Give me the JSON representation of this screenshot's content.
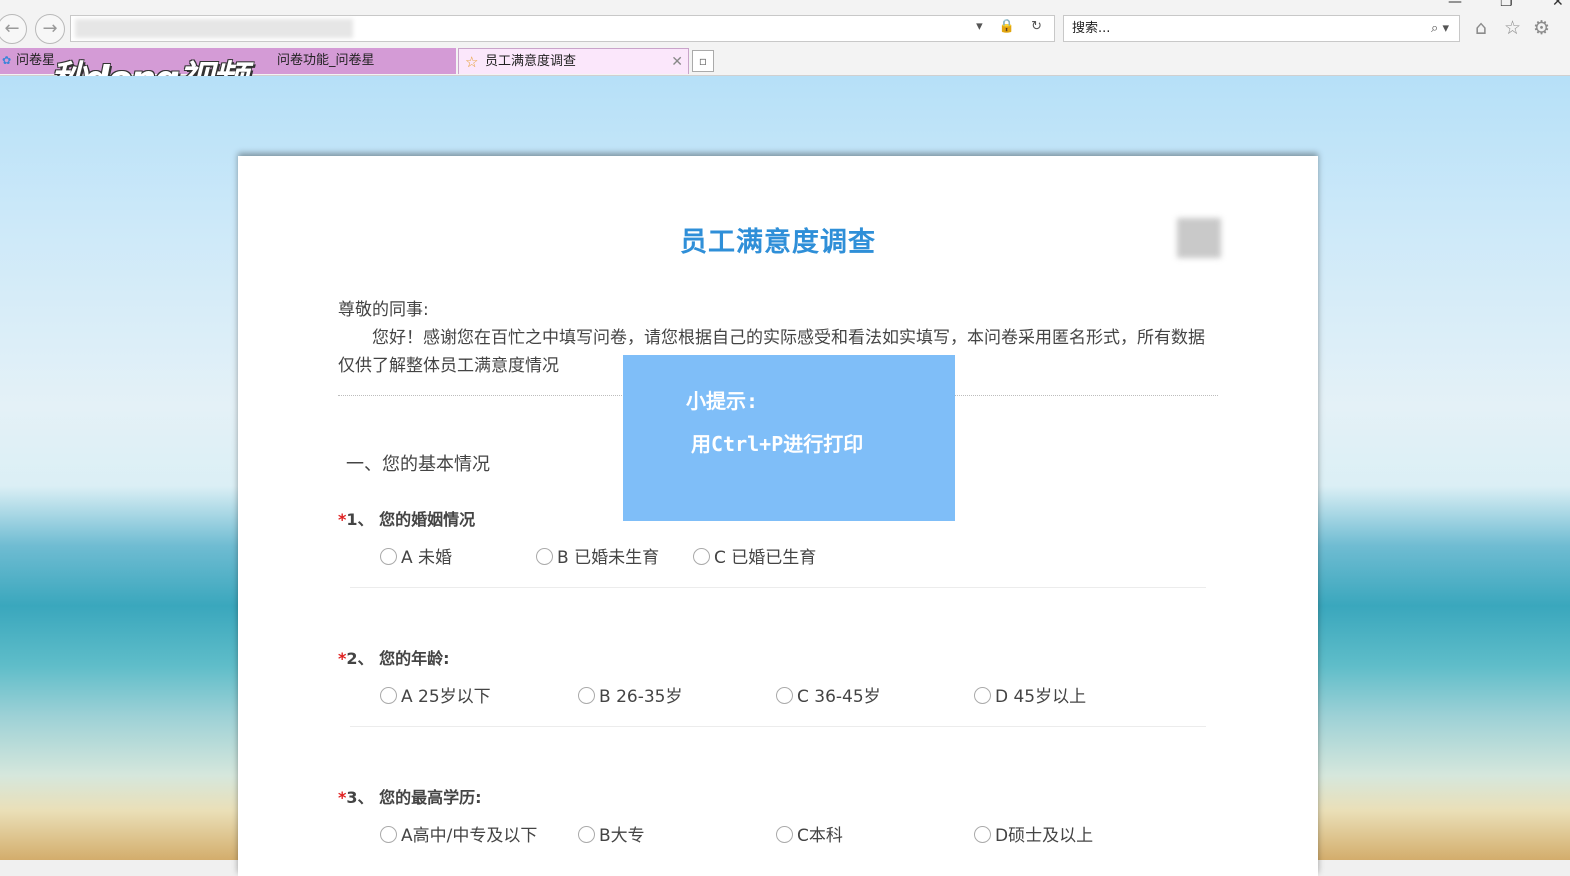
{
  "browser": {
    "search_placeholder": "搜索...",
    "addr_icons": "▾ 🔒 ↻",
    "search_icon": "⌕ ▾",
    "tabs": [
      {
        "label": "问卷星"
      },
      {
        "label": "问卷功能_问卷星"
      },
      {
        "label": "员工满意度调查"
      }
    ]
  },
  "watermark": {
    "logo": "秒dong视频"
  },
  "survey": {
    "title": "员工满意度调查",
    "greeting": "尊敬的同事:",
    "intro": "您好！感谢您在百忙之中填写问卷，请您根据自己的实际感受和看法如实填写，本问卷采用匿名形式，所有数据仅供了解整体员工满意度情况",
    "section": "一、您的基本情况",
    "questions": [
      {
        "required": "*",
        "title": "1、 您的婚姻情况",
        "options": [
          "A 未婚",
          "B 已婚未生育",
          "C 已婚已生育"
        ]
      },
      {
        "required": "*",
        "title": "2、 您的年龄:",
        "options": [
          "A 25岁以下",
          "B 26-35岁",
          "C 36-45岁",
          "D 45岁以上"
        ]
      },
      {
        "required": "*",
        "title": "3、 您的最高学历:",
        "options": [
          "A高中/中专及以下",
          "B大专",
          "C本科",
          "D硕士及以上"
        ]
      }
    ]
  },
  "tip": {
    "title": "小提示:",
    "body": "用Ctrl+P进行打印"
  }
}
